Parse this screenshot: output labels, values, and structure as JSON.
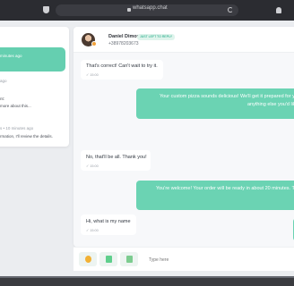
{
  "browser": {
    "url": "whatsapp.chat"
  },
  "sidebar": {
    "items": [
      {
        "time": "minutes ago",
        "snippet": ""
      },
      {
        "line1": "ago",
        "line2": ""
      },
      {
        "line1": "nt:",
        "line2": "more about this..."
      },
      {
        "line1": "s • 10 minutes ago",
        "line2": "rmation, I'll review the details."
      }
    ]
  },
  "chat": {
    "contact_name": "Daniel Dimov",
    "status": "JUST LEFT TO REPLY",
    "phone": "+38978203673",
    "messages": [
      {
        "direction": "in",
        "text": "That's correct! Can't wait to try it.",
        "meta": "✓ 15:00"
      },
      {
        "direction": "out",
        "text": "Your custom pizza sounds delicious! We'll get it prepared for you",
        "text2": "anything else you'd like"
      },
      {
        "direction": "in",
        "text": "No, that'll be all. Thank you!",
        "meta": "✓ 15:00"
      },
      {
        "direction": "out",
        "text": "You're welcome! Your order will be ready in about 20 minutes. Th"
      },
      {
        "direction": "in",
        "text": "Hi, what is my name",
        "meta": "✓ 15:00"
      }
    ]
  },
  "composer": {
    "placeholder": "Type here"
  },
  "colors": {
    "accent": "#6bd3b3",
    "bubble_in": "#ffffff",
    "chrome": "#2b2c31"
  },
  "icons": [
    "shield-icon",
    "lock-icon",
    "reload-icon",
    "bell-icon",
    "emoji-icon",
    "image-icon",
    "file-icon"
  ]
}
